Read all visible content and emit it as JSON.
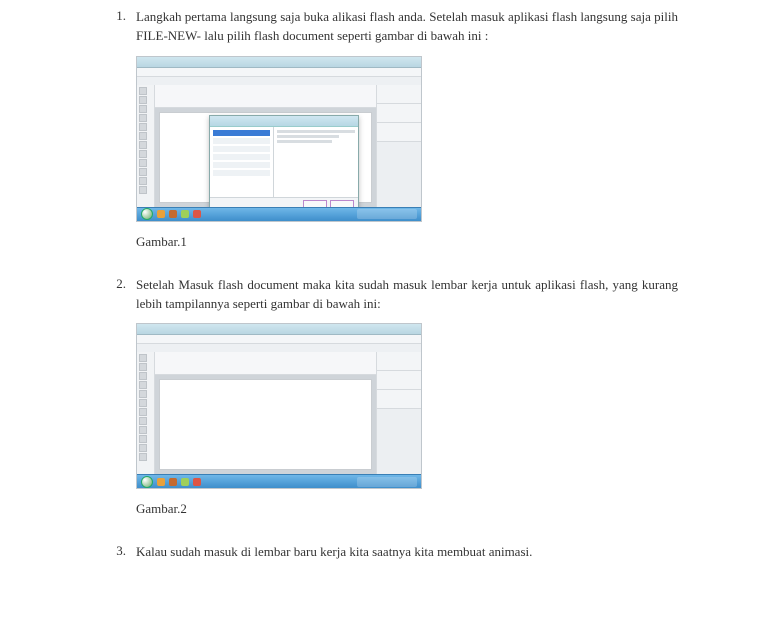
{
  "steps": [
    {
      "num": "1.",
      "text": "Langkah pertama langsung saja buka alikasi flash anda. Setelah masuk aplikasi flash langsung saja pilih FILE-NEW- lalu pilih flash document seperti gambar di bawah ini :",
      "caption": "Gambar.1"
    },
    {
      "num": "2.",
      "text": "Setelah Masuk flash document maka kita sudah masuk lembar kerja untuk aplikasi flash, yang kurang lebih tampilannya seperti gambar di bawah ini:",
      "caption": "Gambar.2"
    },
    {
      "num": "3.",
      "text": "Kalau sudah masuk di lembar baru kerja kita saatnya kita membuat animasi."
    }
  ]
}
